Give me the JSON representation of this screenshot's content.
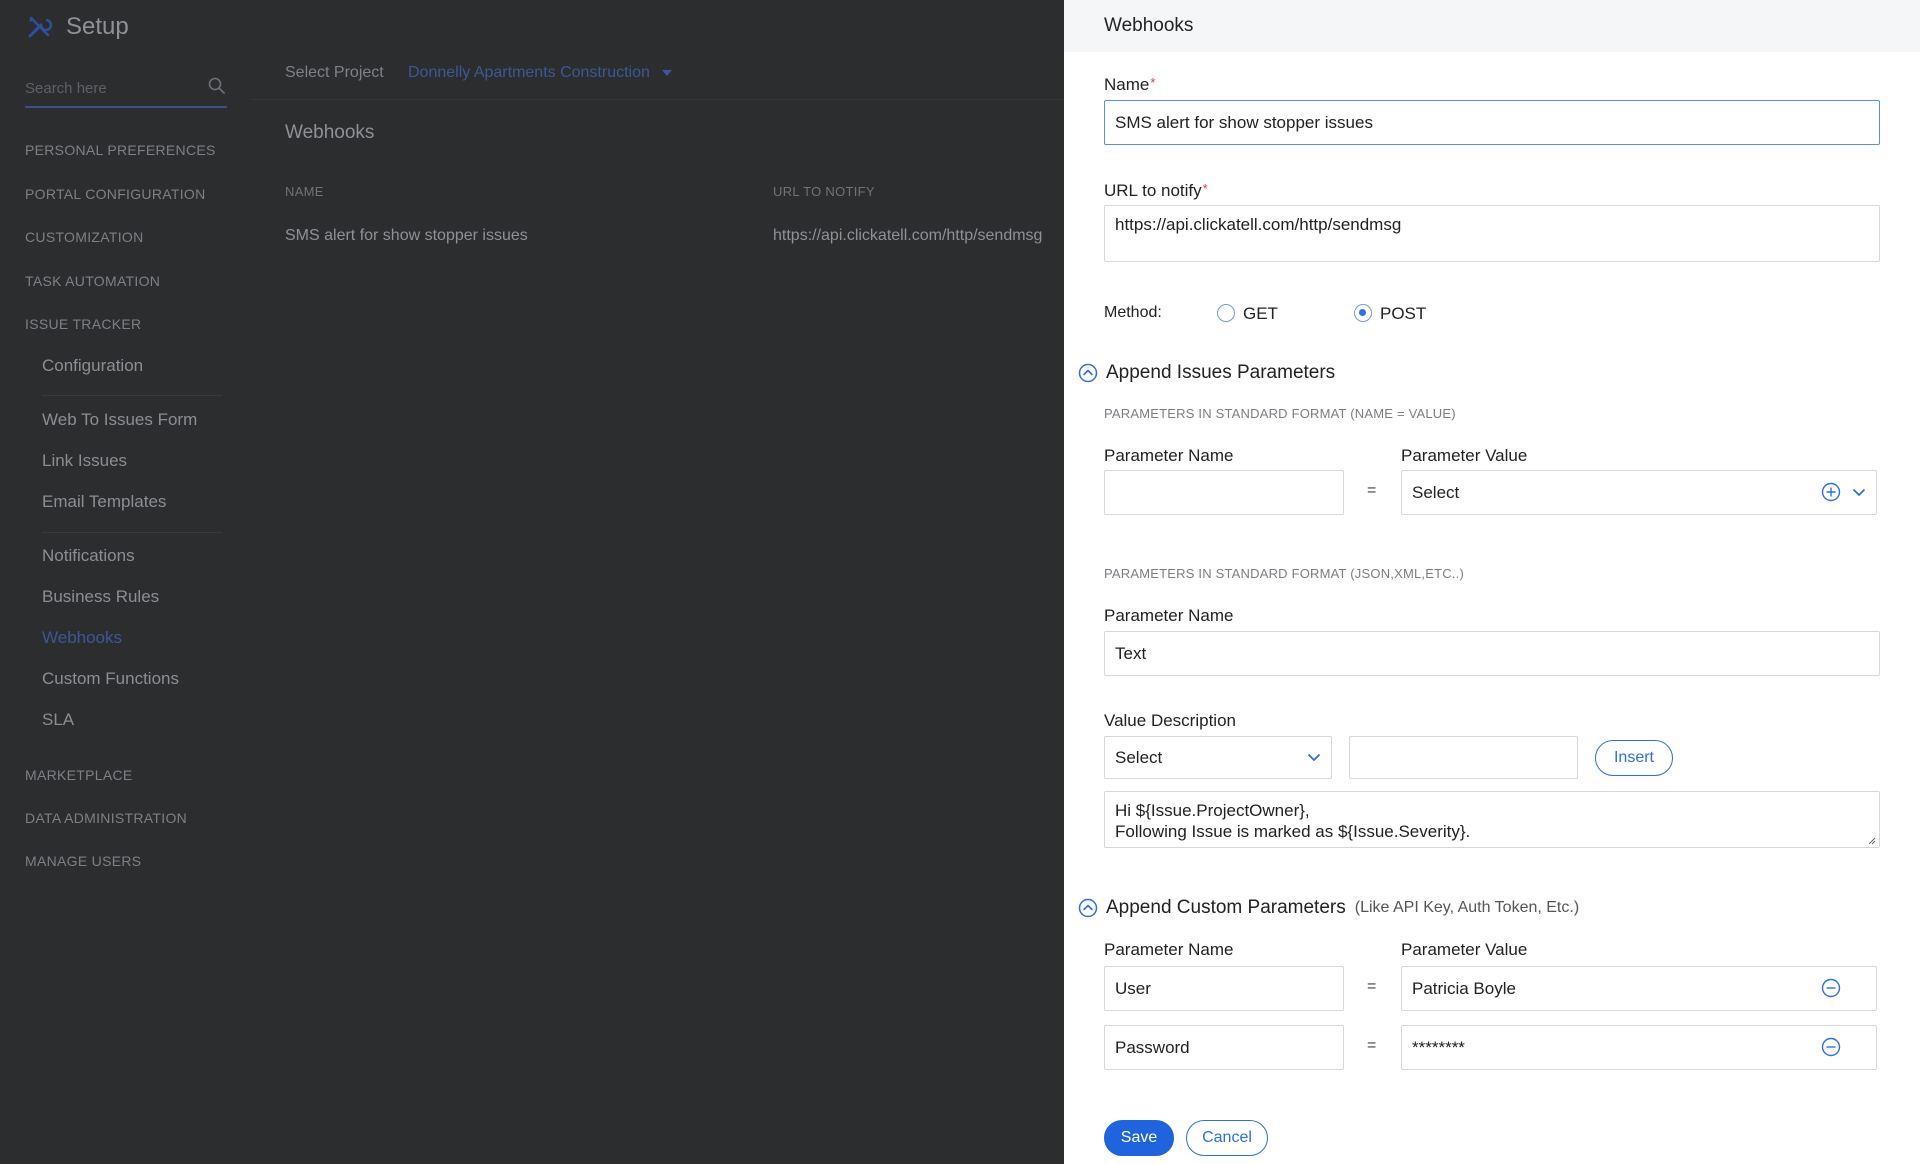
{
  "app": {
    "title": "Setup",
    "search_placeholder": "Search here",
    "nav": {
      "personal_preferences": "PERSONAL PREFERENCES",
      "portal_configuration": "PORTAL CONFIGURATION",
      "customization": "CUSTOMIZATION",
      "task_automation": "TASK AUTOMATION",
      "issue_tracker": "ISSUE TRACKER",
      "configuration": "Configuration",
      "web_to_issues_form": "Web To Issues Form",
      "link_issues": "Link Issues",
      "email_templates": "Email Templates",
      "notifications": "Notifications",
      "business_rules": "Business Rules",
      "webhooks": "Webhooks",
      "custom_functions": "Custom Functions",
      "sla": "SLA",
      "marketplace": "MARKETPLACE",
      "data_administration": "DATA ADMINISTRATION",
      "manage_users": "MANAGE USERS"
    },
    "select_project_label": "Select Project",
    "selected_project": "Donnelly Apartments Construction",
    "content_title": "Webhooks",
    "table": {
      "col_name": "NAME",
      "col_url": "URL TO NOTIFY",
      "row_name": "SMS alert for show stopper issues",
      "row_url": "https://api.clickatell.com/http/sendmsg"
    }
  },
  "panel": {
    "title": "Webhooks",
    "name_label": "Name",
    "required_mark": "*",
    "name_value": "SMS alert for show stopper issues",
    "url_label": "URL to notify",
    "url_value": "https://api.clickatell.com/http/sendmsg",
    "method_label": "Method:",
    "method_get": "GET",
    "method_post": "POST",
    "method_selected": "POST",
    "append_issues_title": "Append Issues Parameters",
    "std_format_heading": "PARAMETERS IN STANDARD FORMAT (NAME = VALUE)",
    "param_name_label": "Parameter Name",
    "param_value_label": "Parameter Value",
    "equals": "=",
    "param_name_value": "",
    "param_value_select": "Select",
    "json_format_heading": "PARAMETERS IN STANDARD FORMAT (JSON,XML,ETC..)",
    "json_param_name_label": "Parameter Name",
    "json_param_name_value": "Text",
    "value_description_label": "Value Description",
    "value_description_select": "Select",
    "value_description_input": "",
    "insert_button": "Insert",
    "message_body": "Hi ${Issue.ProjectOwner},\nFollowing Issue is marked as ${Issue.Severity}.",
    "append_custom_title": "Append Custom Parameters",
    "append_custom_note": "(Like API Key, Auth Token, Etc.)",
    "custom_param_name_label": "Parameter Name",
    "custom_param_value_label": "Parameter Value",
    "custom_params": [
      {
        "name": "User",
        "value": "Patricia Boyle"
      },
      {
        "name": "Password",
        "value": "********"
      }
    ],
    "save_button": "Save",
    "cancel_button": "Cancel"
  },
  "colors": {
    "accent": "#1f63dd",
    "required": "#e03b3b",
    "overlay_bg": "#2c2d2f",
    "panel_header_bg": "#f5f6f7"
  }
}
